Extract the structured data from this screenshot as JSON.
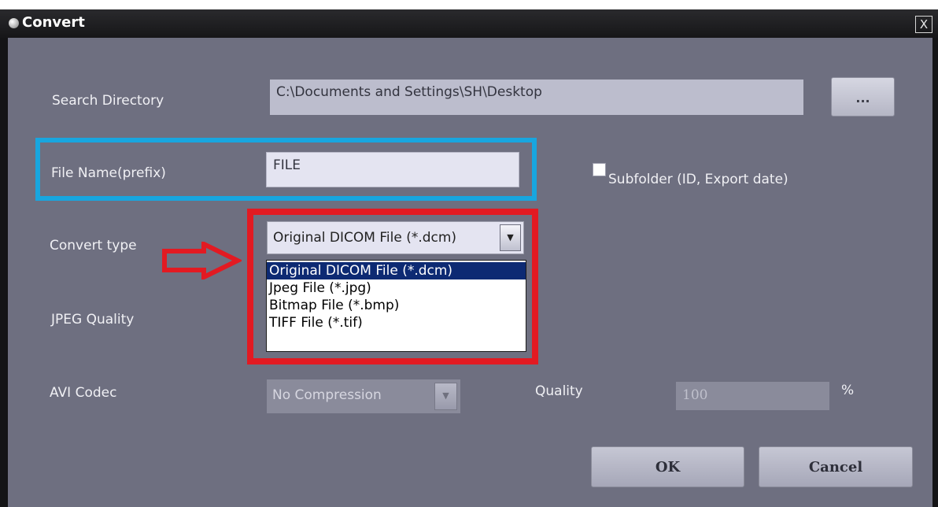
{
  "window": {
    "title": "Convert",
    "close_label": "X"
  },
  "labels": {
    "search_directory": "Search Directory",
    "file_name": "File Name(prefix)",
    "convert_type": "Convert type",
    "jpeg_quality": "JPEG Quality",
    "avi_codec": "AVI Codec",
    "quality": "Quality",
    "percent": "%"
  },
  "fields": {
    "search_directory": "C:\\Documents and Settings\\SH\\Desktop",
    "file_name": "FILE",
    "quality": "100"
  },
  "browse_button": {
    "label": "..."
  },
  "subfolder_checkbox": {
    "label": "Subfolder (ID, Export date)",
    "checked": false
  },
  "convert_type": {
    "selected": "Original DICOM File (*.dcm)",
    "options": [
      "Original DICOM File (*.dcm)",
      "Jpeg File (*.jpg)",
      "Bitmap File (*.bmp)",
      "TIFF File (*.tif)"
    ]
  },
  "avi_codec": {
    "selected": "No Compression"
  },
  "buttons": {
    "ok": "OK",
    "cancel": "Cancel"
  },
  "annotations": {
    "highlight_color": "#18a6df",
    "callout_color": "#e21a22"
  }
}
